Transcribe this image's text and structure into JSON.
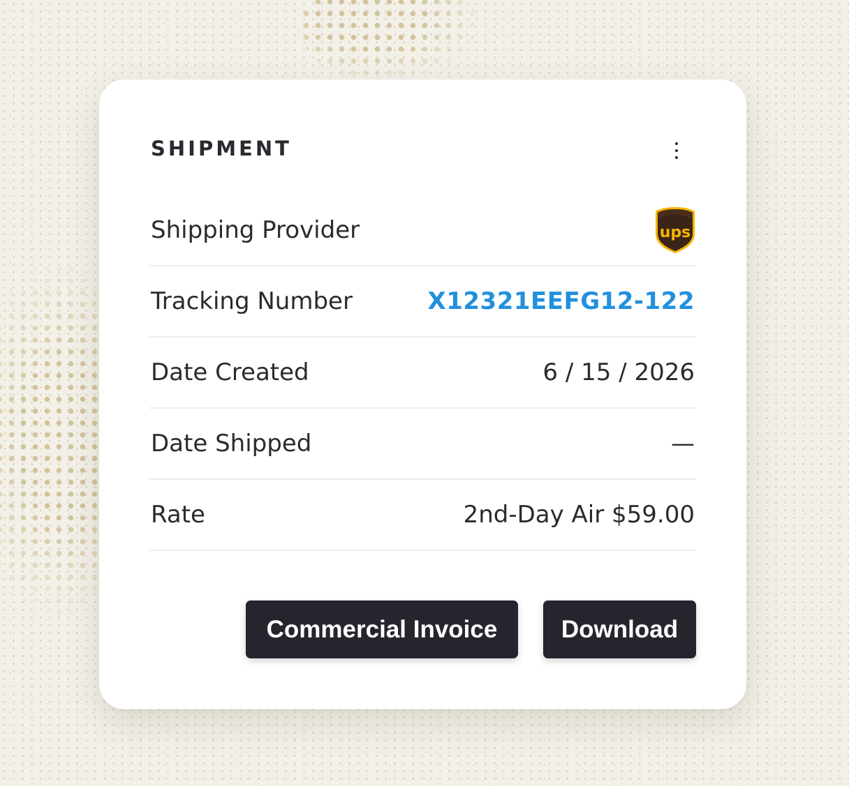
{
  "card": {
    "title": "SHIPMENT",
    "menu_icon": "more-vertical-icon"
  },
  "rows": [
    {
      "label": "Shipping Provider",
      "value": "",
      "icon": "ups-logo"
    },
    {
      "label": "Tracking Number",
      "value": "X12321EEFG12-122"
    },
    {
      "label": "Date Created",
      "value": "6 / 15 / 2026"
    },
    {
      "label": "Date Shipped",
      "value": "—"
    },
    {
      "label": "Rate",
      "value": "2nd-Day Air $59.00"
    }
  ],
  "ups_logo_text": "ups",
  "buttons": {
    "commercial_invoice": "Commercial Invoice",
    "download": "Download"
  },
  "colors": {
    "background": "#f3f0e8",
    "card": "#ffffff",
    "text": "#2b2a30",
    "link": "#2290dd",
    "button": "#26252d",
    "ups_brown": "#3a2418",
    "ups_gold": "#f5b400"
  }
}
